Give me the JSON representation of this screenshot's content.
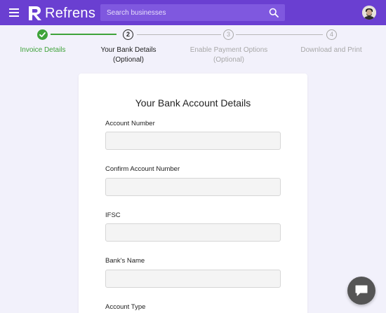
{
  "header": {
    "brand": "Refrens",
    "search_placeholder": "Search businesses"
  },
  "stepper": {
    "steps": [
      {
        "number": "1",
        "label_line1": "Invoice Details",
        "label_line2": "",
        "status": "completed"
      },
      {
        "number": "2",
        "label_line1": "Your Bank Details",
        "label_line2": "(Optional)",
        "status": "active"
      },
      {
        "number": "3",
        "label_line1": "Enable Payment Options",
        "label_line2": "(Optional)",
        "status": "pending"
      },
      {
        "number": "4",
        "label_line1": "Download and Print",
        "label_line2": "",
        "status": "pending"
      }
    ]
  },
  "form": {
    "title": "Your Bank Account Details",
    "fields": [
      {
        "label": "Account Number",
        "value": ""
      },
      {
        "label": "Confirm Account Number",
        "value": ""
      },
      {
        "label": "IFSC",
        "value": ""
      },
      {
        "label": "Bank's Name",
        "value": ""
      },
      {
        "label": "Account Type",
        "value": ""
      }
    ]
  },
  "colors": {
    "brand_purple": "#6a3fd1",
    "success_green": "#3fa33a",
    "page_background": "#f2f1fb"
  }
}
